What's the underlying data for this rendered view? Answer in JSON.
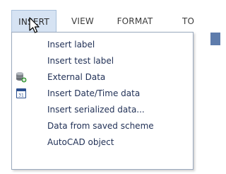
{
  "menubar": {
    "items": [
      {
        "label": "INSERT",
        "active": true
      },
      {
        "label": "VIEW"
      },
      {
        "label": "FORMAT"
      },
      {
        "label": "TO"
      }
    ]
  },
  "dropdown": {
    "items": [
      {
        "label": "Insert label"
      },
      {
        "label": "Insert test label"
      },
      {
        "label": "External Data",
        "icon": "database-add-icon"
      },
      {
        "label": "Insert Date/Time data",
        "icon": "calendar-31-icon",
        "icon_text": "31"
      },
      {
        "label": "Insert serialized data..."
      },
      {
        "label": "Data from saved scheme"
      },
      {
        "label": "AutoCAD object"
      }
    ]
  },
  "colors": {
    "active_menu_bg": "#d6e3f3",
    "menu_text": "#1f2f55",
    "menubar_text": "#3a3a3a",
    "dropdown_border": "#9aa9bd"
  }
}
